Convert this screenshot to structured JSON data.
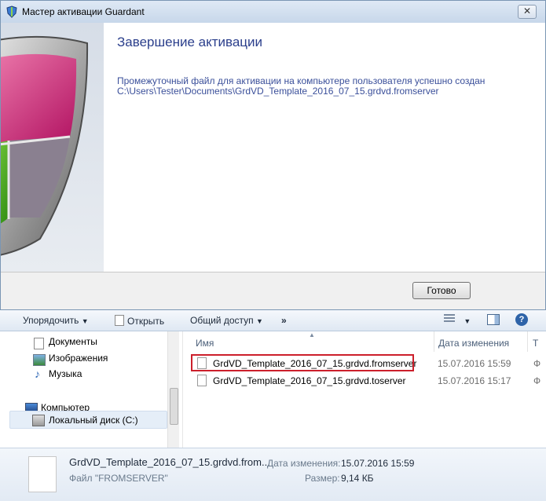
{
  "wizard": {
    "title": "Мастер активации Guardant",
    "close_glyph": "✕",
    "heading": "Завершение активации",
    "message_line1": "Промежуточный файл для активации на компьютере пользователя успешно создан",
    "message_line2": "C:\\Users\\Tester\\Documents\\GrdVD_Template_2016_07_15.grdvd.fromserver",
    "done_button": "Готово"
  },
  "explorer": {
    "toolbar": {
      "organize": "Упорядочить",
      "open": "Открыть",
      "share": "Общий доступ",
      "more": "»"
    },
    "nav": [
      {
        "label": "Документы",
        "icon": "documents-icon"
      },
      {
        "label": "Изображения",
        "icon": "pictures-icon"
      },
      {
        "label": "Музыка",
        "icon": "music-icon"
      },
      {
        "label": "Компьютер",
        "icon": "computer-icon"
      },
      {
        "label": "Локальный диск (C:)",
        "icon": "drive-icon"
      }
    ],
    "columns": {
      "name": "Имя",
      "date": "Дата изменения",
      "type": "Т"
    },
    "files": [
      {
        "name": "GrdVD_Template_2016_07_15.grdvd.fromserver",
        "date": "15.07.2016 15:59",
        "type": "Ф"
      },
      {
        "name": "GrdVD_Template_2016_07_15.grdvd.toserver",
        "date": "15.07.2016 15:17",
        "type": "Ф"
      }
    ],
    "details": {
      "name": "GrdVD_Template_2016_07_15.grdvd.from...",
      "type": "Файл \"FROMSERVER\"",
      "modified_label": "Дата изменения:",
      "modified_value": "15.07.2016 15:59",
      "size_label": "Размер:",
      "size_value": "9,14 КБ"
    },
    "highlight_color": "#cc1f2b"
  }
}
